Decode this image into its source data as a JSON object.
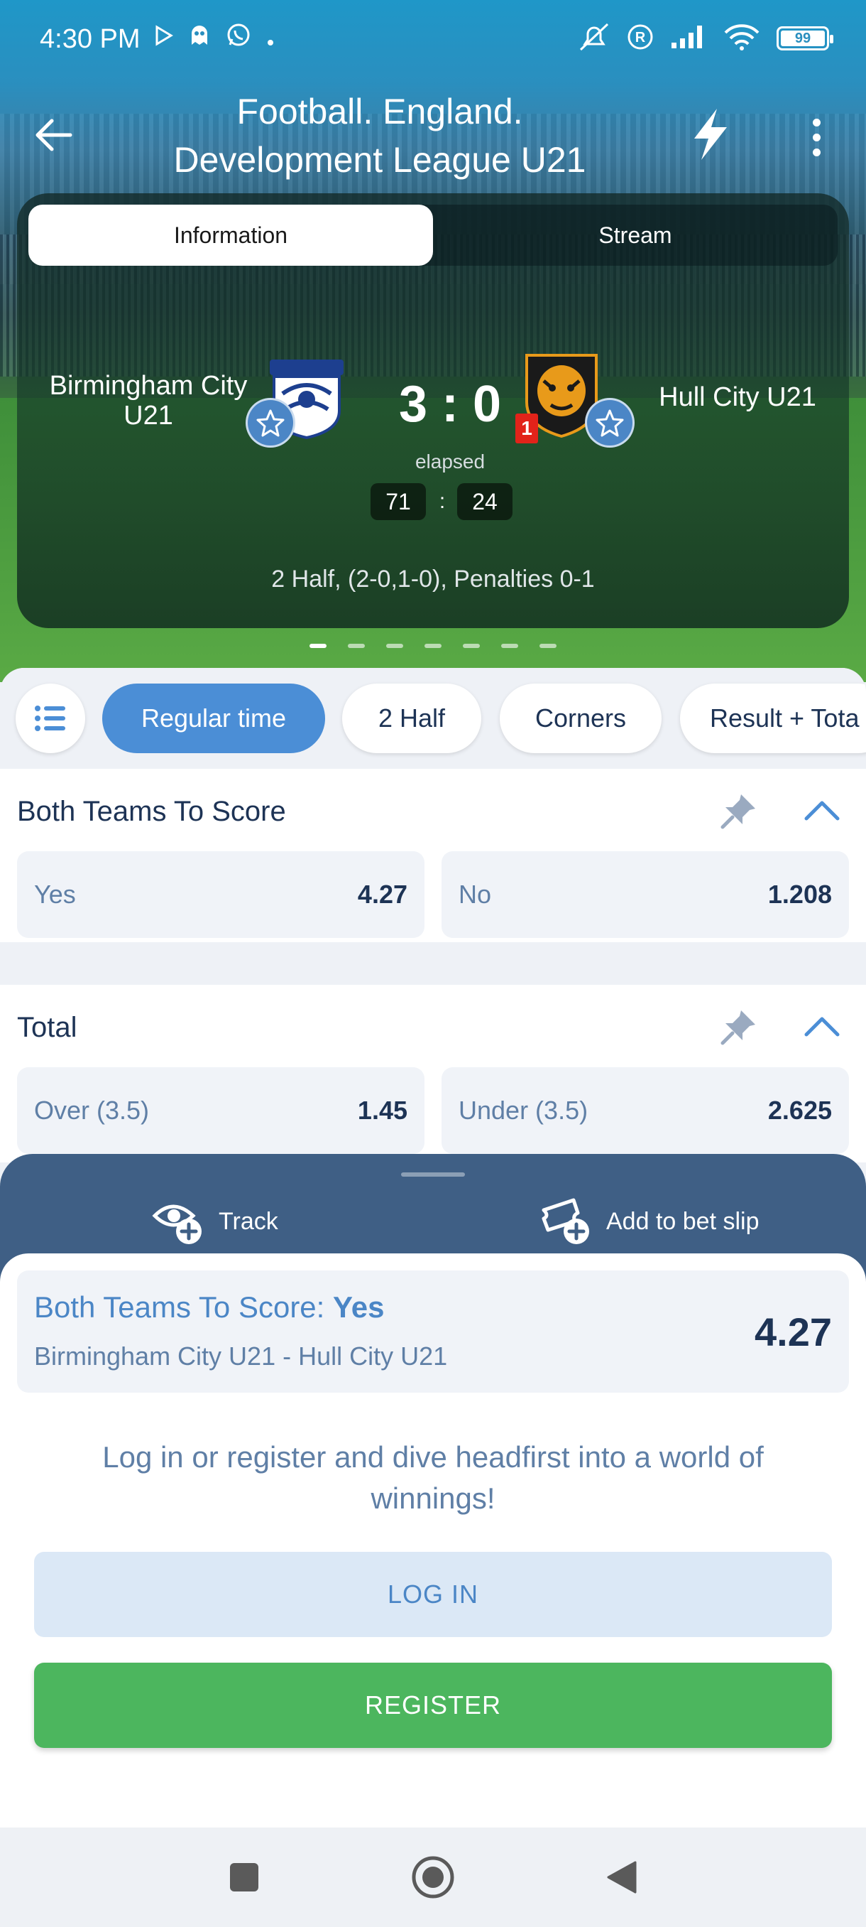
{
  "status_bar": {
    "time": "4:30 PM",
    "battery": "99",
    "left_icons": [
      "play-store-icon",
      "ghost-icon",
      "whatsapp-icon",
      "dot-icon"
    ],
    "right_icons": [
      "mute-icon",
      "registered-icon",
      "signal-icon",
      "wifi-icon",
      "battery-icon"
    ]
  },
  "header": {
    "title_line1": "Football. England.",
    "title_line2": "Development League U21",
    "back_icon": "arrow-left-icon",
    "bolt_icon": "lightning-icon",
    "more_icon": "more-vertical-icon"
  },
  "match_card": {
    "tabs": [
      {
        "label": "Information",
        "active": true
      },
      {
        "label": "Stream",
        "active": false
      }
    ],
    "home_team": "Birmingham City U21",
    "away_team": "Hull City U21",
    "score": "3 : 0",
    "elapsed_label": "elapsed",
    "clock_minutes": "71",
    "clock_separator": ":",
    "clock_seconds": "24",
    "red_cards_away": "1",
    "period_info": "2 Half, (2-0,1-0), Penalties 0-1",
    "page_count": 7,
    "active_page": 1
  },
  "filters": {
    "chips": [
      "Regular time",
      "2 Half",
      "Corners",
      "Result + Tota"
    ],
    "active_chip": "Regular time"
  },
  "markets": [
    {
      "title": "Both Teams To Score",
      "outcomes": [
        {
          "label": "Yes",
          "odd": "4.27"
        },
        {
          "label": "No",
          "odd": "1.208"
        }
      ]
    },
    {
      "title": "Total",
      "outcomes": [
        {
          "label": "Over (3.5)",
          "odd": "1.45"
        },
        {
          "label": "Under (3.5)",
          "odd": "2.625"
        }
      ]
    }
  ],
  "bottom_sheet": {
    "track_label": "Track",
    "add_label": "Add to bet slip",
    "selection": {
      "market_prefix": "Both Teams To Score: ",
      "outcome": "Yes",
      "event": "Birmingham City U21 - Hull City U21",
      "odd": "4.27"
    },
    "promo_text": "Log in or register and dive headfirst into a world of winnings!",
    "login_label": "LOG IN",
    "register_label": "REGISTER"
  },
  "colors": {
    "accent": "#4b8ed6",
    "primary_text": "#1d3355",
    "secondary_text": "#5f7fa6",
    "sheet": "#3f5f85",
    "register": "#4cb65e",
    "red_card": "#e2231a"
  }
}
